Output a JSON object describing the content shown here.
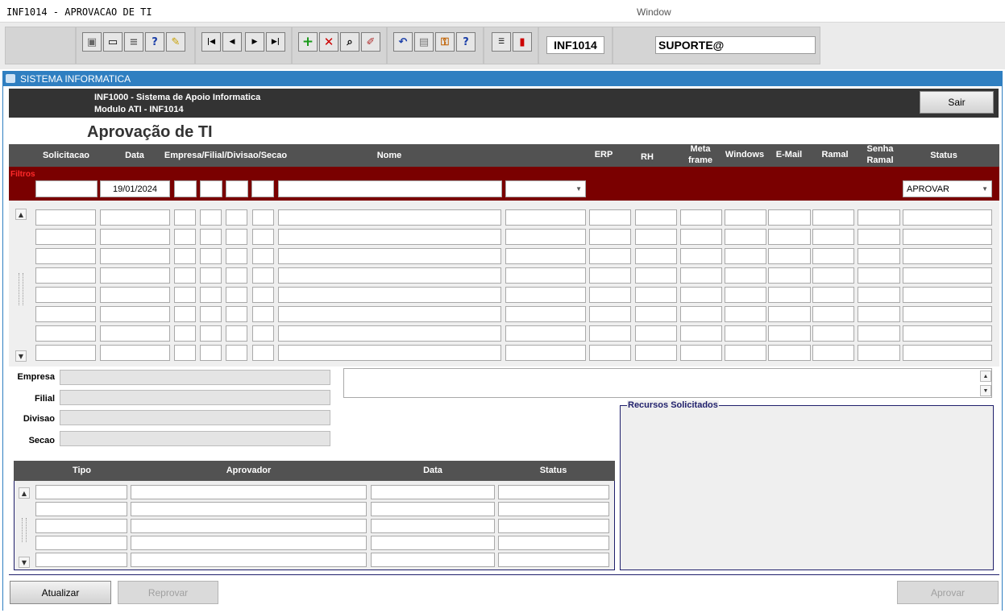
{
  "window": {
    "title": "INF1014 - APROVACAO DE TI",
    "menu_label": "Window"
  },
  "toolbar": {
    "form_code": "INF1014",
    "user": "SUPORTE@",
    "icons": [
      "save-icon",
      "print-preview-icon",
      "printer-icon",
      "help-query-icon",
      "edit-query-icon",
      "first-record-icon",
      "previous-record-icon",
      "next-record-icon",
      "last-record-icon",
      "add-record-icon",
      "delete-record-icon",
      "search-record-icon",
      "clear-record-icon",
      "undo-icon",
      "clipboard-icon",
      "user-key-icon",
      "help-icon",
      "menu-icon",
      "exit-icon"
    ]
  },
  "app": {
    "section_title": "SISTEMA INFORMATICA",
    "header_line1": "INF1000 - Sistema de Apoio Informatica",
    "header_line2": "Modulo ATI - INF1014",
    "exit_label": "Sair",
    "page_title": "Aprovação de TI"
  },
  "grid": {
    "columns": {
      "solicitacao": "Solicitacao",
      "data": "Data",
      "empresa": "Empresa/Filial/Divisao/Secao",
      "nome": "Nome",
      "erp": "ERP",
      "rh": "RH",
      "meta1": "Meta",
      "meta2": "frame",
      "windows": "Windows",
      "email": "E-Mail",
      "ramal": "Ramal",
      "senha1": "Senha",
      "senha2": "Ramal",
      "status": "Status"
    },
    "filter_label": "Filtros",
    "filter_date": "19/01/2024",
    "filter_status": "APROVAR",
    "row_count": 8
  },
  "details": {
    "empresa_label": "Empresa",
    "filial_label": "Filial",
    "divisao_label": "Divisao",
    "secao_label": "Secao",
    "recursos_label": "Recursos Solicitados"
  },
  "approvers": {
    "col_tipo": "Tipo",
    "col_aprovador": "Aprovador",
    "col_data": "Data",
    "col_status": "Status",
    "row_count": 5
  },
  "buttons": {
    "atualizar": "Atualizar",
    "reprovar": "Reprovar",
    "aprovar": "Aprovar"
  }
}
